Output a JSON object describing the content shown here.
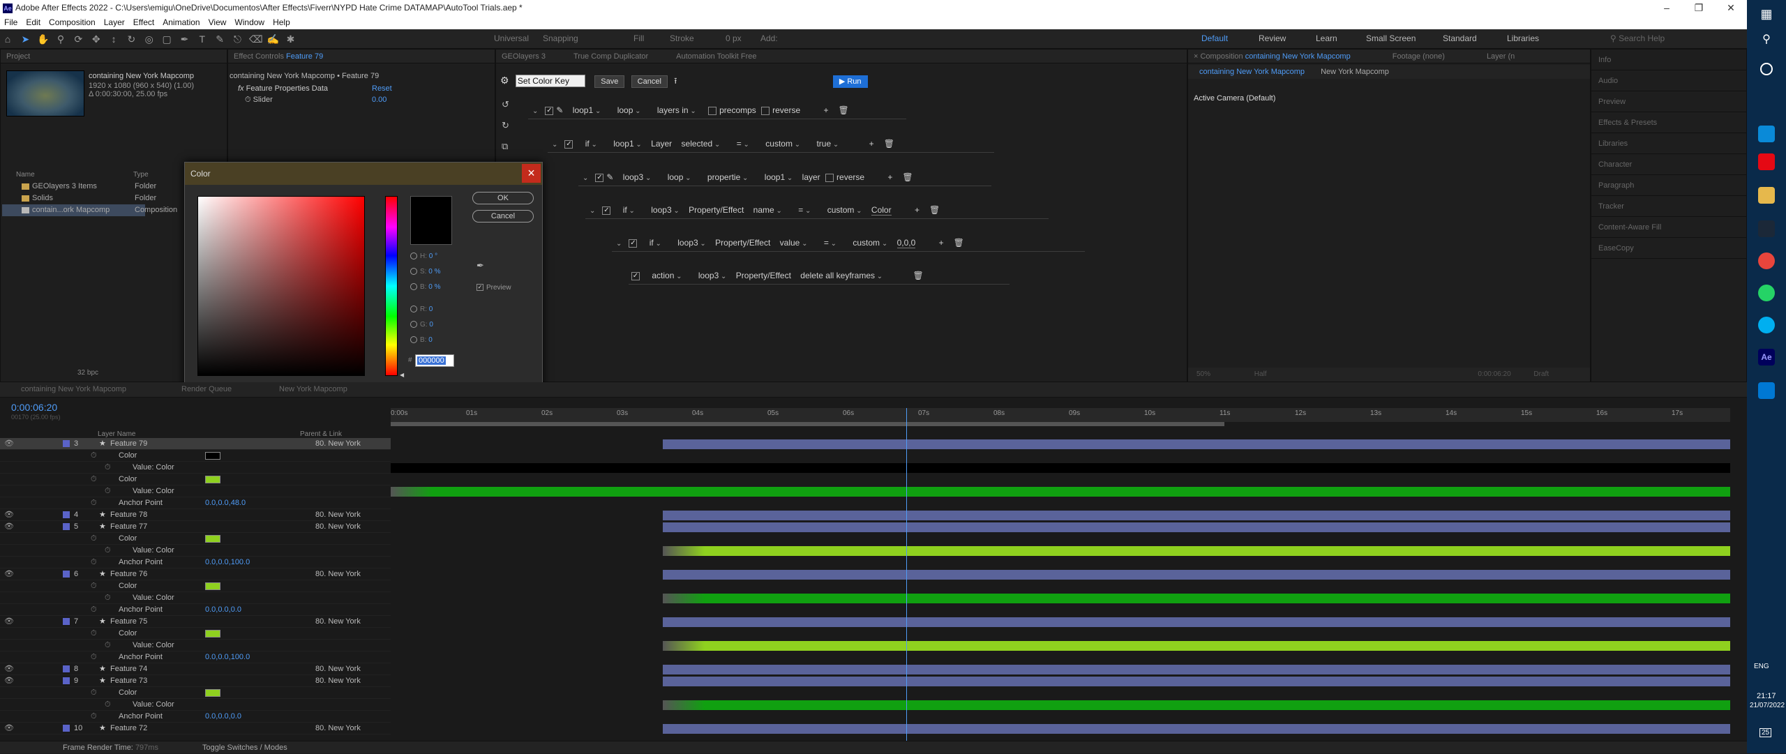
{
  "window": {
    "title": "Adobe After Effects 2022 - C:\\Users\\emigu\\OneDrive\\Documentos\\After Effects\\Fiverr\\NYPD Hate Crime DATAMAP\\AutoTool Trials.aep *",
    "app_badge": "Ae"
  },
  "menu": [
    "File",
    "Edit",
    "Composition",
    "Layer",
    "Effect",
    "Animation",
    "View",
    "Window",
    "Help"
  ],
  "toolbar": {
    "universal": "Universal",
    "snapping": "Snapping",
    "fill": "Fill",
    "stroke": "Stroke",
    "stroke_px": "0 px",
    "add": "Add:",
    "workspaces": [
      "Default",
      "Review",
      "Learn",
      "Small Screen",
      "Standard",
      "Libraries"
    ],
    "search_placeholder": "Search Help"
  },
  "project": {
    "tab": "Project",
    "comp_name": "containing New York Mapcomp",
    "comp_info1": "1920 x 1080  (960 x 540) (1.00)",
    "comp_info2": "Δ 0:00:30:00, 25.00 fps",
    "col_name": "Name",
    "col_type": "Type",
    "items": [
      {
        "name": "GEOlayers 3 Items",
        "type": "Folder"
      },
      {
        "name": "Solids",
        "type": "Folder"
      },
      {
        "name": "contain...ork Mapcomp",
        "type": "Composition"
      }
    ],
    "bpc": "32 bpc"
  },
  "fx": {
    "tab": "Effect Controls",
    "tab_layer": "Feature 79",
    "path": "containing New York Mapcomp • Feature 79",
    "group": "Feature Properties Data",
    "reset": "Reset",
    "slider": "Slider",
    "slider_val": "0.00"
  },
  "colordlg": {
    "title": "Color",
    "ok": "OK",
    "cancel": "Cancel",
    "h_label": "H:",
    "h": "0 °",
    "s_label": "S:",
    "s": "0 %",
    "b_label": "B:",
    "b": "0 %",
    "r_label": "R:",
    "r": "0",
    "g_label": "G:",
    "g": "0",
    "bb_label": "B:",
    "bb": "0",
    "hex_prefix": "#",
    "hex": "000000",
    "preview": "Preview"
  },
  "atk": {
    "tabs": [
      "GEOlayers 3",
      "True Comp Duplicator",
      "Automation Toolkit Free"
    ],
    "input": "Set Color Key",
    "save": "Save",
    "cancel": "Cancel",
    "run": "▶ Run",
    "rows": [
      {
        "a": "loop1",
        "b": "loop",
        "c": "layers in",
        "d": "precomps",
        "e": "reverse"
      },
      {
        "a": "if",
        "b": "loop1",
        "c": "Layer",
        "d": "selected",
        "e": "=",
        "f": "custom",
        "g": "true"
      },
      {
        "a": "loop3",
        "b": "loop",
        "c": "propertie",
        "d": "loop1",
        "e": "layer",
        "f": "reverse"
      },
      {
        "a": "if",
        "b": "loop3",
        "c": "Property/Effect",
        "d": "name",
        "e": "=",
        "f": "custom",
        "g": "Color"
      },
      {
        "a": "if",
        "b": "loop3",
        "c": "Property/Effect",
        "d": "value",
        "e": "=",
        "f": "custom",
        "g": "0,0,0"
      },
      {
        "a": "action",
        "b": "loop3",
        "c": "Property/Effect",
        "d": "delete all keyframes"
      }
    ]
  },
  "comp": {
    "tab": "Composition",
    "tab_name": "containing New York Mapcomp",
    "footage": "Footage (none)",
    "layer": "Layer (n",
    "crumb1": "containing New York Mapcomp",
    "crumb2": "New York Mapcomp",
    "camera": "Active Camera (Default)",
    "zoom": "50%",
    "quality": "Half",
    "time": "0:00:06:20",
    "view": "Draft"
  },
  "rightpanels": [
    "Info",
    "Audio",
    "Preview",
    "Effects & Presets",
    "Libraries",
    "Character",
    "Paragraph",
    "Tracker",
    "Content-Aware Fill",
    "EaseCopy"
  ],
  "timeline": {
    "tabs": [
      "containing New York Mapcomp",
      "Render Queue",
      "New York Mapcomp"
    ],
    "timecode": "0:00:06:20",
    "frames": "00170 (25.00 fps)",
    "col_layer": "Layer Name",
    "col_parent": "Parent & Link",
    "ticks": [
      "0:00s",
      "01s",
      "02s",
      "03s",
      "04s",
      "05s",
      "06s",
      "07s",
      "08s",
      "09s",
      "10s",
      "11s",
      "12s",
      "13s",
      "14s",
      "15s",
      "16s",
      "17s"
    ],
    "rows": [
      {
        "n": "3",
        "name": "Feature 79",
        "parent": "80. New York",
        "type": "layer"
      },
      {
        "name": "Color",
        "type": "prop"
      },
      {
        "name": "Value: Color",
        "type": "sub"
      },
      {
        "name": "Color",
        "type": "prop"
      },
      {
        "name": "Value: Color",
        "type": "sub"
      },
      {
        "name": "Anchor Point",
        "val": "0.0,0.0,48.0",
        "type": "prop"
      },
      {
        "n": "4",
        "name": "Feature 78",
        "parent": "80. New York",
        "type": "layer"
      },
      {
        "n": "5",
        "name": "Feature 77",
        "parent": "80. New York",
        "type": "layer"
      },
      {
        "name": "Color",
        "type": "prop"
      },
      {
        "name": "Value: Color",
        "type": "sub"
      },
      {
        "name": "Anchor Point",
        "val": "0.0,0.0,100.0",
        "type": "prop"
      },
      {
        "n": "6",
        "name": "Feature 76",
        "parent": "80. New York",
        "type": "layer"
      },
      {
        "name": "Color",
        "type": "prop"
      },
      {
        "name": "Value: Color",
        "type": "sub"
      },
      {
        "name": "Anchor Point",
        "val": "0.0,0.0,0.0",
        "type": "prop"
      },
      {
        "n": "7",
        "name": "Feature 75",
        "parent": "80. New York",
        "type": "layer"
      },
      {
        "name": "Color",
        "type": "prop"
      },
      {
        "name": "Value: Color",
        "type": "sub"
      },
      {
        "name": "Anchor Point",
        "val": "0.0,0.0,100.0",
        "type": "prop"
      },
      {
        "n": "8",
        "name": "Feature 74",
        "parent": "80. New York",
        "type": "layer"
      },
      {
        "n": "9",
        "name": "Feature 73",
        "parent": "80. New York",
        "type": "layer"
      },
      {
        "name": "Color",
        "type": "prop"
      },
      {
        "name": "Value: Color",
        "type": "sub"
      },
      {
        "name": "Anchor Point",
        "val": "0.0,0.0,0.0",
        "type": "prop"
      },
      {
        "n": "10",
        "name": "Feature 72",
        "parent": "80. New York",
        "type": "layer"
      }
    ],
    "render_time_label": "Frame Render Time:",
    "render_time": "797ms",
    "toggle": "Toggle Switches / Modes"
  },
  "taskbar": {
    "time": "21:17",
    "date": "21/07/2022",
    "lang": "ENG",
    "notif": "25"
  },
  "colors": {
    "accent": "#4f9cf7",
    "bar": "#5a639a",
    "green": "#10a010",
    "lime": "#8fd11f"
  }
}
